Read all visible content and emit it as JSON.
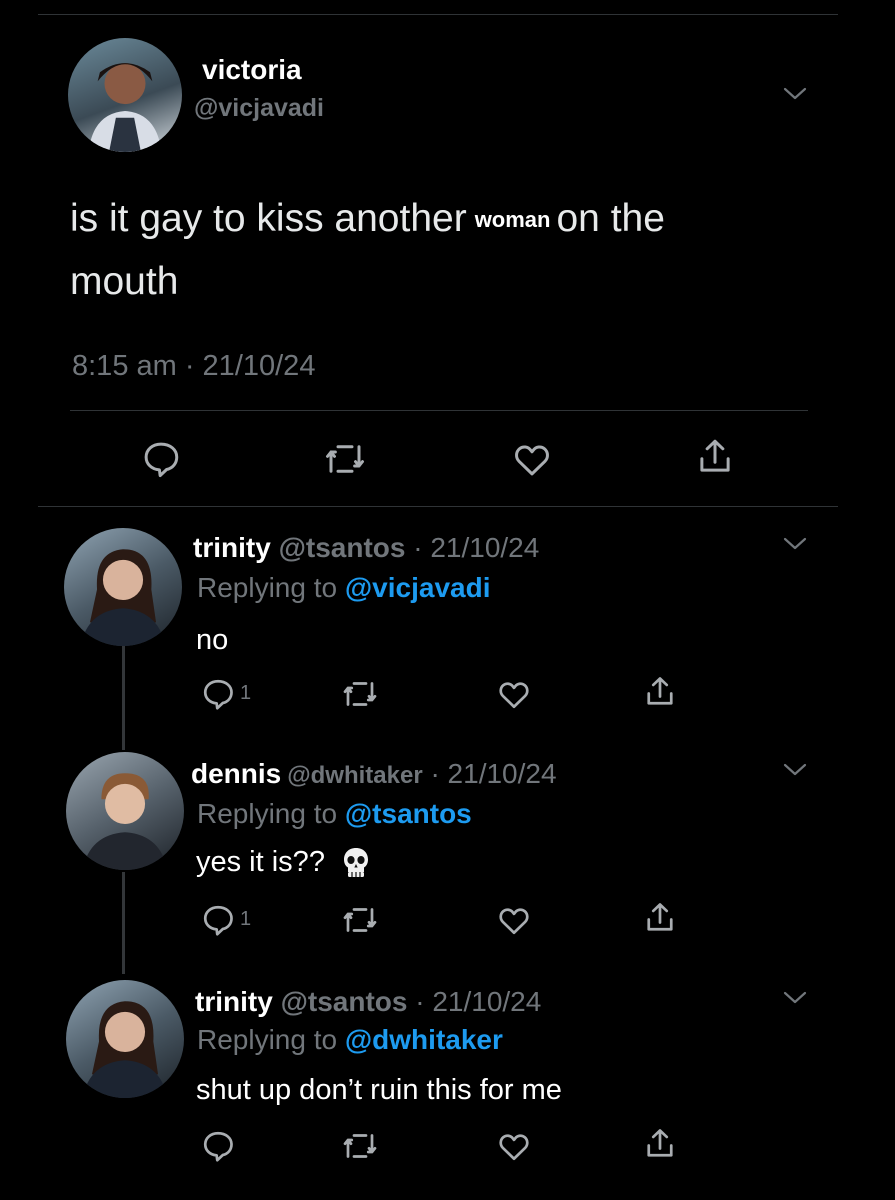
{
  "main_tweet": {
    "name": "victoria",
    "handle": "@vicjavadi",
    "text_part1": "is it gay to kiss another",
    "text_highlight": "woman",
    "text_part2": "on the",
    "text_line2": "mouth",
    "timestamp": "8:15 am · 21/10/24"
  },
  "replies": [
    {
      "name": "trinity",
      "handle": "@tsantos",
      "date": "· 21/10/24",
      "replying_label": "Replying to",
      "replying_to": "@vicjavadi",
      "text": "no",
      "reply_count": "1"
    },
    {
      "name": "dennis",
      "handle": "@dwhitaker",
      "date": "· 21/10/24",
      "replying_label": "Replying to",
      "replying_to": "@tsantos",
      "text": "yes it is??",
      "emoji": "skull-emoji",
      "reply_count": "1"
    },
    {
      "name": "trinity",
      "handle": "@tsantos",
      "date": "· 21/10/24",
      "replying_label": "Replying to",
      "replying_to": "@dwhitaker",
      "text": "shut up don’t ruin this for me",
      "reply_count": ""
    }
  ],
  "icons": {
    "reply": "reply-icon",
    "retweet": "retweet-icon",
    "like": "like-icon",
    "share": "share-icon",
    "menu": "chevron-down-icon"
  },
  "colors": {
    "background": "#000000",
    "text": "#e7e9ea",
    "muted": "#71767b",
    "link": "#1d9bf0",
    "divider": "#2f3336"
  }
}
